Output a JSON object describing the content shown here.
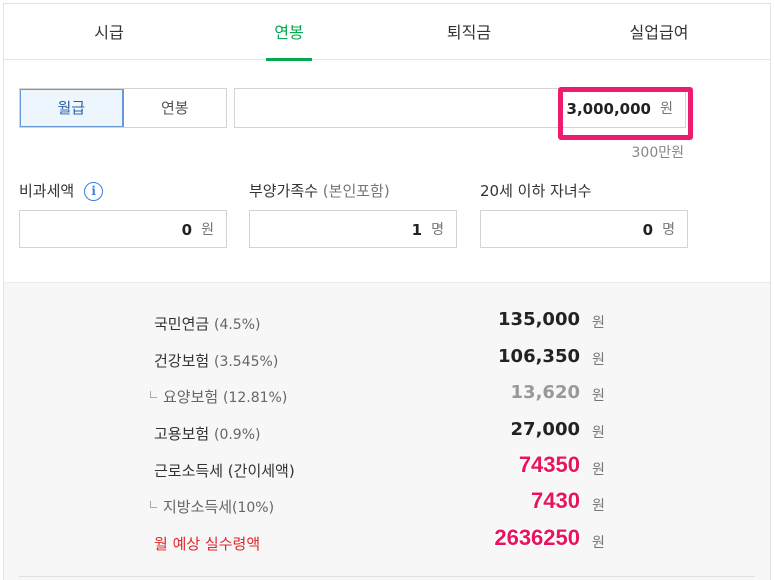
{
  "tabs": [
    {
      "label": "시급"
    },
    {
      "label": "연봉"
    },
    {
      "label": "퇴직금"
    },
    {
      "label": "실업급여"
    }
  ],
  "toggle": {
    "monthly": "월급",
    "annual": "연봉",
    "selected": "월급"
  },
  "amount": {
    "value": "3,000,000",
    "unit": "원",
    "hint": "300만원"
  },
  "fields": {
    "nontax": {
      "label": "비과세액",
      "value": "0",
      "unit": "원"
    },
    "dependents": {
      "label": "부양가족수",
      "sublabel": "(본인포함)",
      "value": "1",
      "unit": "명"
    },
    "children": {
      "label": "20세 이하 자녀수",
      "value": "0",
      "unit": "명"
    }
  },
  "results": {
    "pension": {
      "label": "국민연금",
      "pct": "(4.5%)",
      "value": "135,000",
      "unit": "원"
    },
    "health": {
      "label": "건강보험",
      "pct": "(3.545%)",
      "value": "106,350",
      "unit": "원"
    },
    "care": {
      "label": "요양보험",
      "pct": "(12.81%)",
      "value": "13,620",
      "unit": "원"
    },
    "employment": {
      "label": "고용보험",
      "pct": "(0.9%)",
      "value": "27,000",
      "unit": "원"
    },
    "income_tax": {
      "label": "근로소득세",
      "pct": "(간이세액)",
      "value": "74350",
      "unit": "원"
    },
    "local_tax": {
      "label": "지방소득세",
      "pct": "(10%)",
      "value": "7430",
      "unit": "원"
    },
    "net": {
      "label": "월 예상 실수령액",
      "value": "2636250",
      "unit": "원"
    }
  },
  "colors": {
    "accent": "#03a94e",
    "highlight": "#ee1c6e",
    "net_label": "#e0262d"
  }
}
